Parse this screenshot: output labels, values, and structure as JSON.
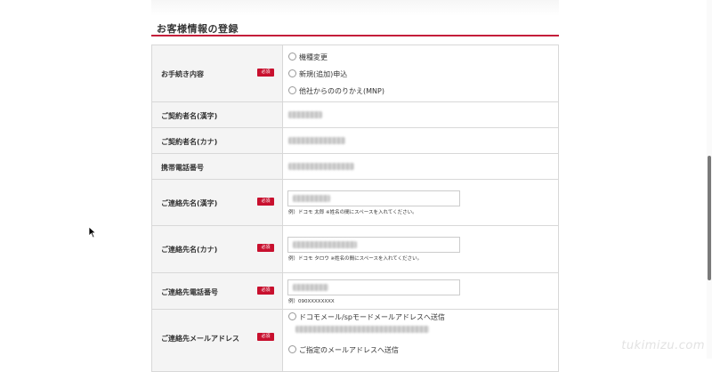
{
  "section_title": "お客様情報の登録",
  "required_badge": "必須",
  "fields": {
    "procedure": {
      "label": "お手続き内容",
      "options": [
        "機種変更",
        "新規(追加)申込",
        "他社からののりかえ(MNP)"
      ]
    },
    "contractor_kanji": {
      "label": "ご契約者名(漢字)"
    },
    "contractor_kana": {
      "label": "ご契約者名(カナ)"
    },
    "mobile_number": {
      "label": "携帯電話番号"
    },
    "contact_kanji": {
      "label": "ご連絡先名(漢字)",
      "hint": "例）ドコモ 太郎 ※姓名の間にスペースを入れてください。"
    },
    "contact_kana": {
      "label": "ご連絡先名(カナ)",
      "hint": "例）ドコモ タロウ ※姓名の間にスペースを入れてください。"
    },
    "contact_phone": {
      "label": "ご連絡先電話番号",
      "hint": "例）090XXXXXXXX"
    },
    "contact_email": {
      "label": "ご連絡先メールアドレス",
      "options": [
        "ドコモメール/spモードメールアドレスへ送信",
        "ご指定のメールアドレスへ送信"
      ]
    }
  },
  "watermark": "tukimizu.com"
}
